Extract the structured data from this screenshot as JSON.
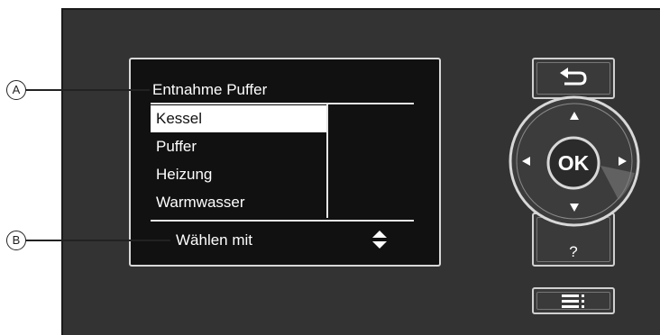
{
  "display": {
    "title": "Entnahme Puffer",
    "menu_items": [
      {
        "label": "Kessel",
        "selected": true
      },
      {
        "label": "Puffer",
        "selected": false
      },
      {
        "label": "Heizung",
        "selected": false
      },
      {
        "label": "Warmwasser",
        "selected": false
      }
    ],
    "hint": "Wählen mit",
    "hint_icon": "up-down-arrows-icon"
  },
  "callouts": {
    "a": "A",
    "b": "B"
  },
  "controls": {
    "ok_label": "OK",
    "help_label": "?",
    "back_icon": "back-arrow-icon",
    "menu_icon": "menu-icon",
    "arrows": [
      "arrow-up-icon",
      "arrow-down-icon",
      "arrow-left-icon",
      "arrow-right-icon"
    ]
  },
  "colors": {
    "panel": "#333333",
    "display_background": "#111111",
    "display_text": "#ffffff",
    "selection_background": "#ffffff"
  }
}
